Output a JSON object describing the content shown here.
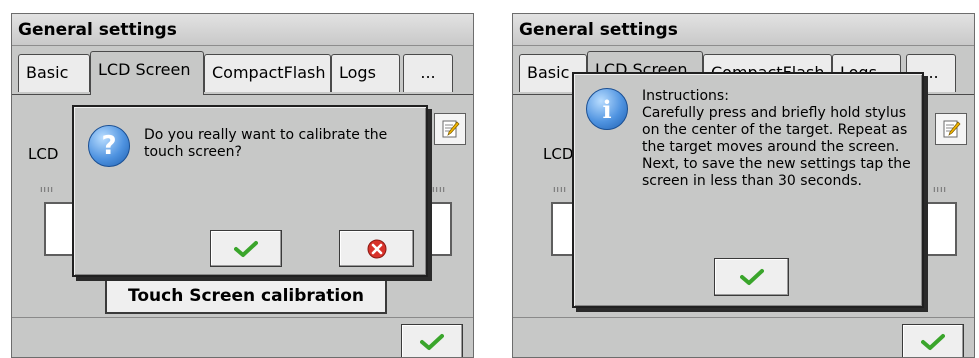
{
  "window_title": "General settings",
  "tabs": [
    "Basic",
    "LCD Screen",
    "CompactFlash",
    "Logs",
    "..."
  ],
  "lcd_label": "LCD",
  "calibration_button": "Touch Screen calibration",
  "dialogs": {
    "confirm": {
      "message": "Do you really want to calibrate the touch screen?",
      "icon": "question-icon"
    },
    "instructions": {
      "title": "Instructions:",
      "message": "Carefully press and briefly hold stylus on the center of the target. Repeat as the target moves around the screen. Next, to save the new settings tap the screen in less than 30 seconds.",
      "icon": "info-icon"
    }
  },
  "icons": {
    "ok": "checkmark-icon",
    "cancel": "cancel-x-icon",
    "edit": "notepad-icon"
  },
  "colors": {
    "window_bg": "#c7c8c7",
    "ok_green": "#3aa52b",
    "cancel_red": "#d8322a",
    "info_blue": "#2f78d1"
  }
}
